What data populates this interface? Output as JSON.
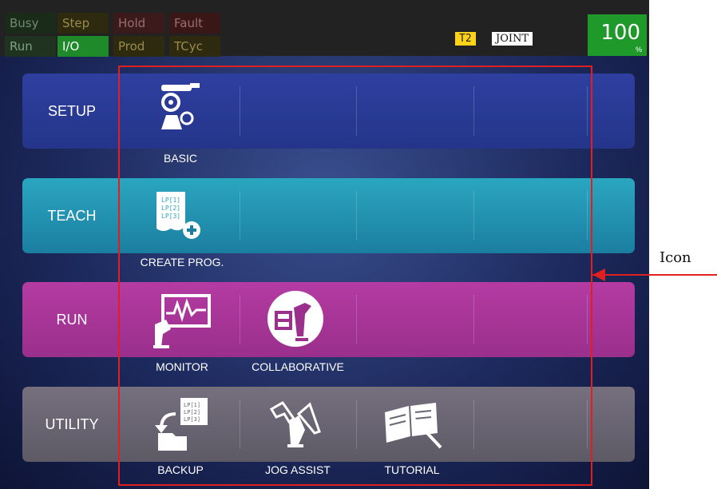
{
  "status": {
    "lamps": [
      "Busy",
      "Step",
      "Hold",
      "Fault",
      "Run",
      "I/O",
      "Prod",
      "TCyc"
    ],
    "mode": "T2",
    "coord": "JOINT",
    "override_value": "100",
    "override_unit": "%"
  },
  "rows": [
    {
      "label": "SETUP",
      "tiles": [
        {
          "label": "BASIC",
          "icon": "robot-gear-icon"
        }
      ]
    },
    {
      "label": "TEACH",
      "tiles": [
        {
          "label": "CREATE PROG.",
          "icon": "create-program-icon"
        }
      ]
    },
    {
      "label": "RUN",
      "tiles": [
        {
          "label": "MONITOR",
          "icon": "monitor-icon"
        },
        {
          "label": "COLLABORATIVE",
          "icon": "collaborative-icon"
        }
      ]
    },
    {
      "label": "UTILITY",
      "tiles": [
        {
          "label": "BACKUP",
          "icon": "backup-icon"
        },
        {
          "label": "JOG ASSIST",
          "icon": "jog-assist-icon"
        },
        {
          "label": "TUTORIAL",
          "icon": "tutorial-book-icon"
        }
      ]
    }
  ],
  "annotation": {
    "label": "Icon",
    "color": "#e02020"
  }
}
